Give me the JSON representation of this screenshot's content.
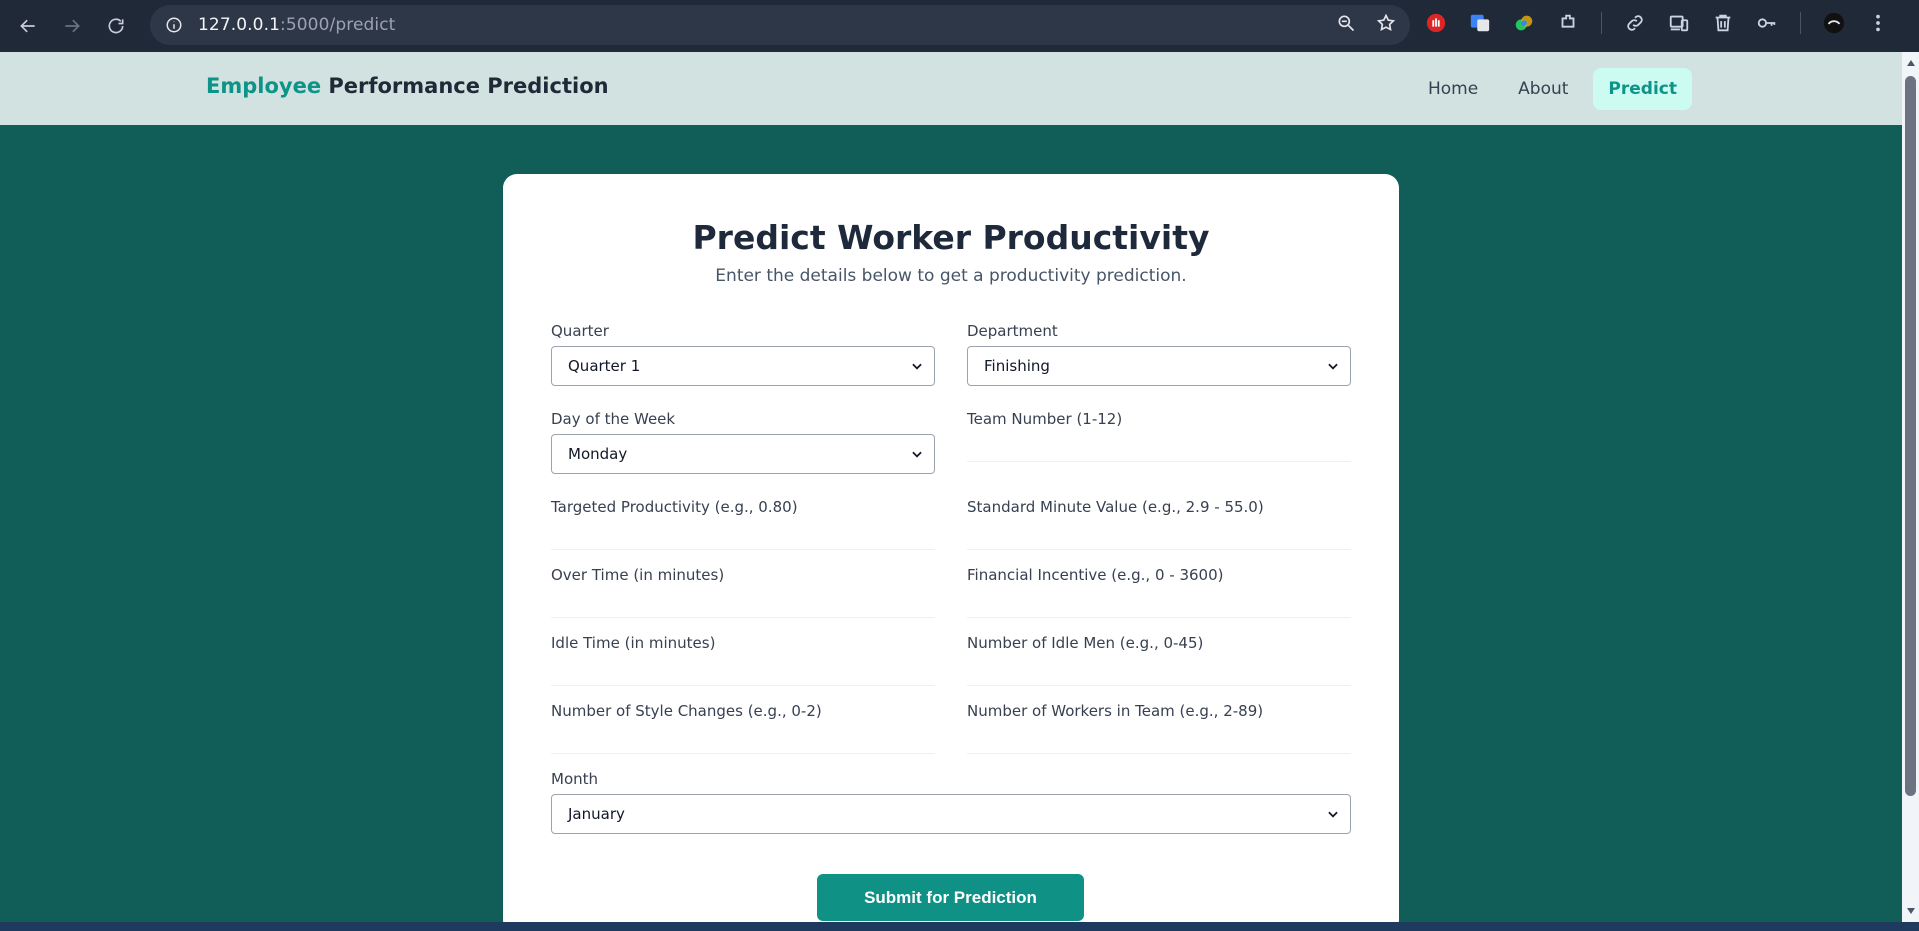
{
  "browser": {
    "url_host": "127.0.0.1",
    "url_port_path": ":5000/predict"
  },
  "header": {
    "brand_accent": "Employee",
    "brand_rest": " Performance Prediction",
    "nav": [
      {
        "label": "Home",
        "active": false
      },
      {
        "label": "About",
        "active": false
      },
      {
        "label": "Predict",
        "active": true
      }
    ]
  },
  "form": {
    "title": "Predict Worker Productivity",
    "subtitle": "Enter the details below to get a productivity prediction.",
    "quarter": {
      "label": "Quarter",
      "value": "Quarter 1"
    },
    "department": {
      "label": "Department",
      "value": "Finishing"
    },
    "day": {
      "label": "Day of the Week",
      "value": "Monday"
    },
    "team": {
      "label": "Team Number (1-12)",
      "value": ""
    },
    "targeted": {
      "label": "Targeted Productivity (e.g., 0.80)",
      "value": ""
    },
    "smv": {
      "label": "Standard Minute Value (e.g., 2.9 - 55.0)",
      "value": ""
    },
    "overtime": {
      "label": "Over Time (in minutes)",
      "value": ""
    },
    "incentive": {
      "label": "Financial Incentive (e.g., 0 - 3600)",
      "value": ""
    },
    "idle_time": {
      "label": "Idle Time (in minutes)",
      "value": ""
    },
    "idle_men": {
      "label": "Number of Idle Men (e.g., 0-45)",
      "value": ""
    },
    "style_changes": {
      "label": "Number of Style Changes (e.g., 0-2)",
      "value": ""
    },
    "workers": {
      "label": "Number of Workers in Team (e.g., 2-89)",
      "value": ""
    },
    "month": {
      "label": "Month",
      "value": "January"
    },
    "submit_label": "Submit for Prediction"
  },
  "colors": {
    "page_bg": "#115e59",
    "accent": "#0d9488",
    "header_bg": "#d1e2e0",
    "active_nav_bg": "#ccfbf1"
  }
}
